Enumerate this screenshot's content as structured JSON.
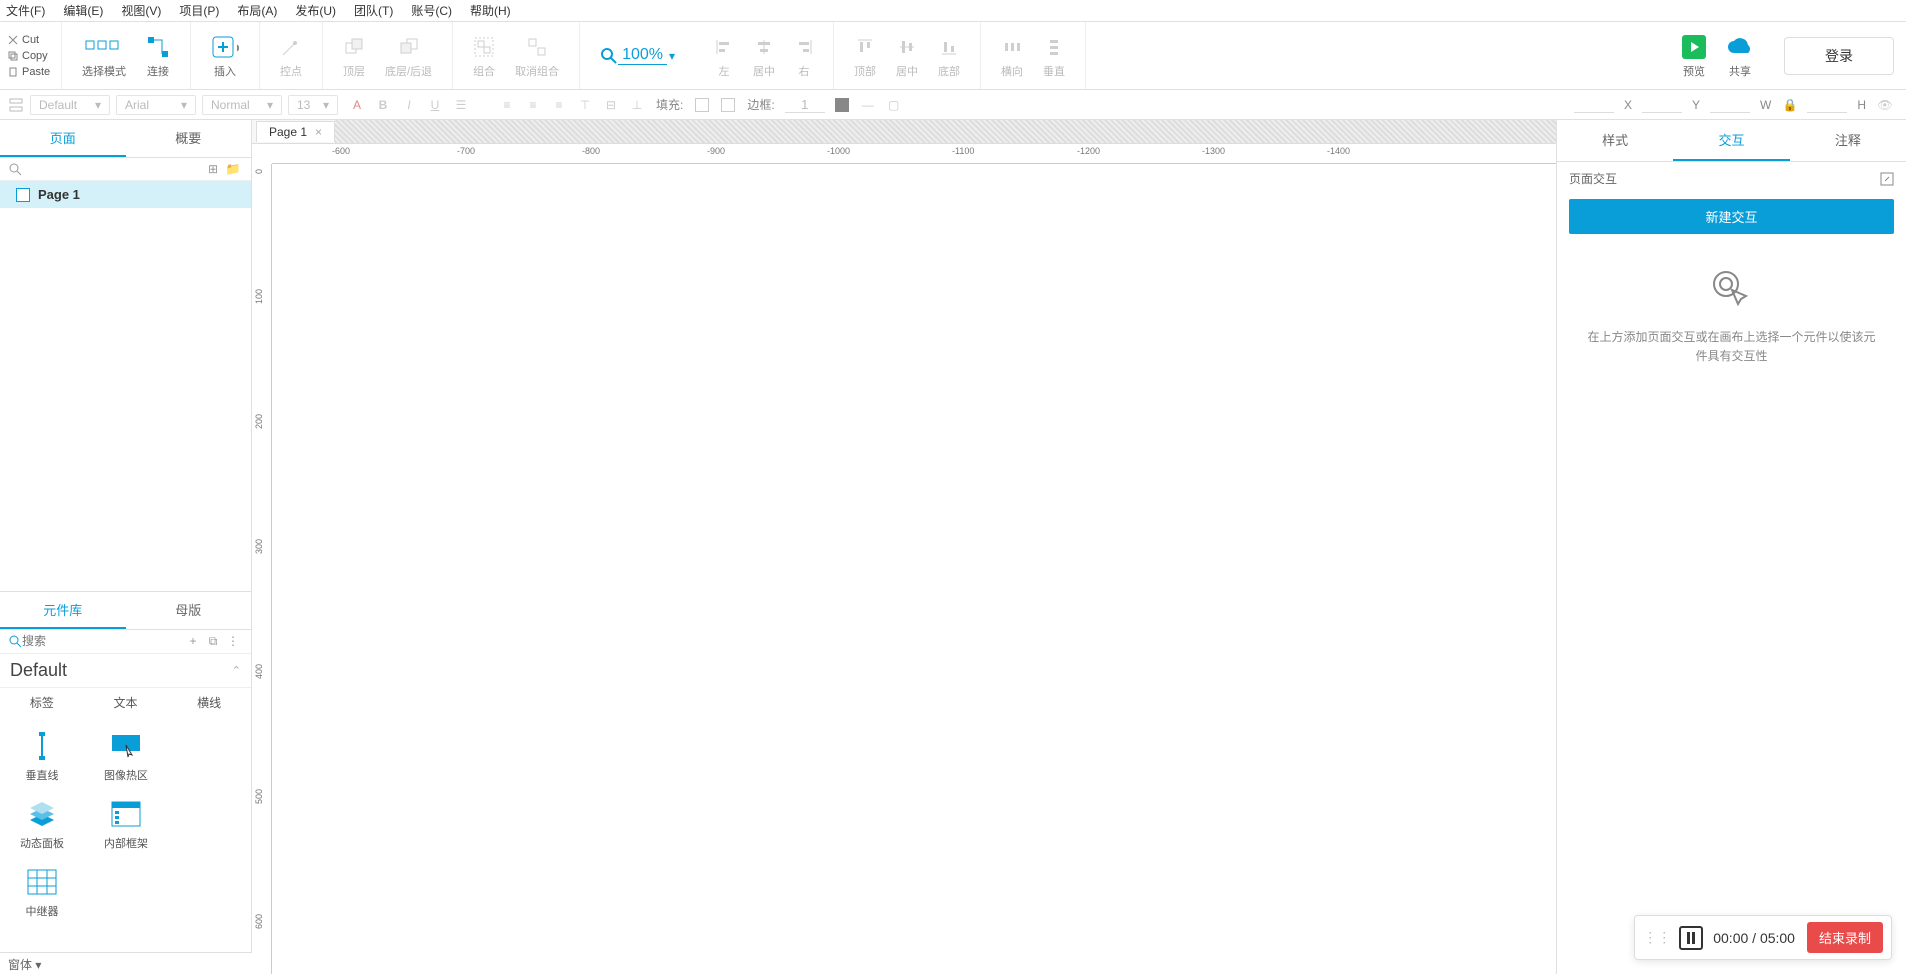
{
  "menubar": [
    "文件(F)",
    "编辑(E)",
    "视图(V)",
    "项目(P)",
    "布局(A)",
    "发布(U)",
    "团队(T)",
    "账号(C)",
    "帮助(H)"
  ],
  "edit": {
    "cut": "Cut",
    "copy": "Copy",
    "paste": "Paste"
  },
  "tools": {
    "select": "选择模式",
    "connect": "连接",
    "insert": "插入",
    "point": "控点",
    "top": "顶层",
    "bottom": "底层/后退",
    "group": "组合",
    "ungroup": "取消组合",
    "left": "左",
    "center": "居中",
    "right": "右",
    "vtop": "顶部",
    "vcenter": "居中",
    "vbottom": "底部",
    "horiz": "横向",
    "vert": "垂直",
    "preview": "预览",
    "share": "共享",
    "login": "登录"
  },
  "zoom": "100%",
  "format": {
    "default": "Default",
    "font": "Arial",
    "weight": "Normal",
    "size": "13",
    "fill": "填充:",
    "border": "边框:",
    "borderW": "1",
    "x": "X",
    "y": "Y",
    "w": "W",
    "h": "H"
  },
  "left": {
    "tabs": {
      "pages": "页面",
      "outline": "概要"
    },
    "page1": "Page 1",
    "libTabs": {
      "widgets": "元件库",
      "masters": "母版"
    },
    "searchPlaceholder": "搜索",
    "libName": "Default",
    "cats": [
      "标签",
      "文本",
      "横线"
    ],
    "items": [
      "垂直线",
      "图像热区",
      "动态面板",
      "内部框架",
      "中继器"
    ]
  },
  "canvas": {
    "tab": "Page 1",
    "rulerH": [
      -600,
      -700,
      -800,
      -900,
      -1000,
      -1100,
      -1200,
      -1300,
      -1400
    ],
    "rulerV": [
      0,
      100,
      200,
      300,
      400,
      500,
      600
    ]
  },
  "right": {
    "tabs": {
      "style": "样式",
      "interact": "交互",
      "notes": "注释"
    },
    "head": "页面交互",
    "newBtn": "新建交互",
    "empty": "在上方添加页面交互或在画布上选择一个元件以使该元件具有交互性"
  },
  "rec": {
    "time": "00:00 / 05:00",
    "stop": "结束录制"
  },
  "footer": "窗体 ▾"
}
